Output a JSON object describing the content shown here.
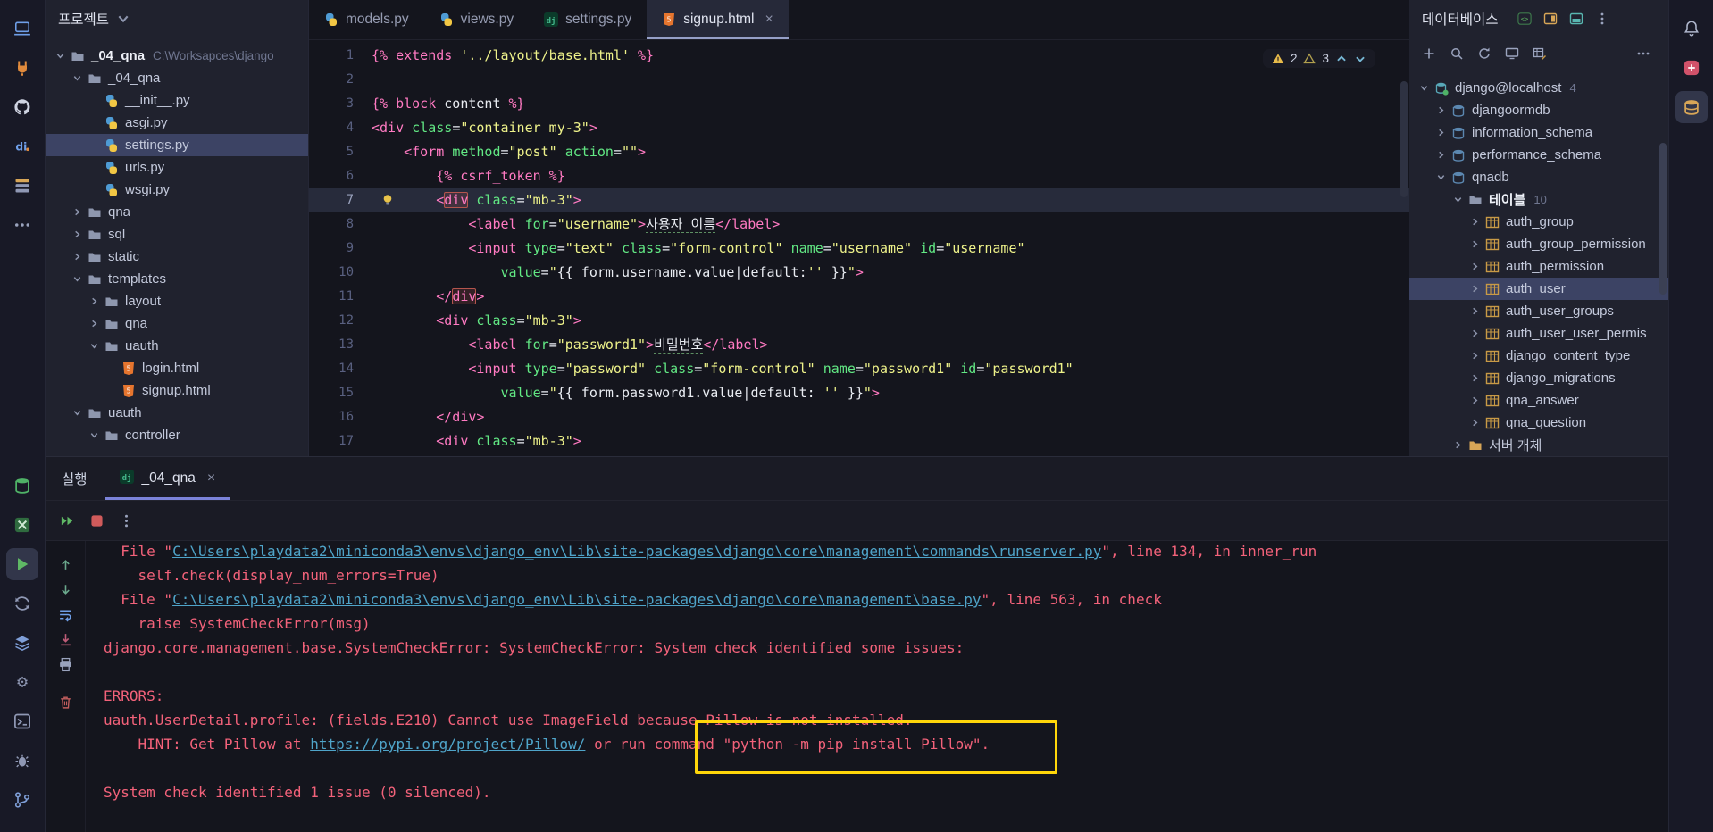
{
  "project_panel": {
    "title": "프로젝트",
    "tree": [
      {
        "label": "_04_qna",
        "hint": "C:\\Worksapces\\django",
        "indent": 0,
        "chevron": "down",
        "icon": "folder",
        "bold": true
      },
      {
        "label": "_04_qna",
        "indent": 1,
        "chevron": "down",
        "icon": "folder"
      },
      {
        "label": "__init__.py",
        "indent": 2,
        "icon": "py"
      },
      {
        "label": "asgi.py",
        "indent": 2,
        "icon": "py"
      },
      {
        "label": "settings.py",
        "indent": 2,
        "icon": "py",
        "selected": true
      },
      {
        "label": "urls.py",
        "indent": 2,
        "icon": "py"
      },
      {
        "label": "wsgi.py",
        "indent": 2,
        "icon": "py"
      },
      {
        "label": "qna",
        "indent": 1,
        "chevron": "right",
        "icon": "folder"
      },
      {
        "label": "sql",
        "indent": 1,
        "chevron": "right",
        "icon": "folder"
      },
      {
        "label": "static",
        "indent": 1,
        "chevron": "right",
        "icon": "folder"
      },
      {
        "label": "templates",
        "indent": 1,
        "chevron": "down",
        "icon": "folder"
      },
      {
        "label": "layout",
        "indent": 2,
        "chevron": "right",
        "icon": "folder"
      },
      {
        "label": "qna",
        "indent": 2,
        "chevron": "right",
        "icon": "folder"
      },
      {
        "label": "uauth",
        "indent": 2,
        "chevron": "down",
        "icon": "folder"
      },
      {
        "label": "login.html",
        "indent": 3,
        "icon": "html"
      },
      {
        "label": "signup.html",
        "indent": 3,
        "icon": "html"
      },
      {
        "label": "uauth",
        "indent": 1,
        "chevron": "down",
        "icon": "folder"
      },
      {
        "label": "controller",
        "indent": 2,
        "chevron": "down",
        "icon": "folder"
      }
    ]
  },
  "editor": {
    "tabs": [
      {
        "label": "models.py",
        "icon": "py"
      },
      {
        "label": "views.py",
        "icon": "py"
      },
      {
        "label": "settings.py",
        "icon": "dj"
      },
      {
        "label": "signup.html",
        "icon": "html",
        "active": true,
        "close": "×"
      }
    ],
    "inspections": {
      "warnings": "2",
      "weak_warnings": "3"
    },
    "current_line": 7,
    "code_lines": [
      [
        [
          "p",
          "{% "
        ],
        [
          "p",
          "extends "
        ],
        [
          "y",
          "'../layout/base.html'"
        ],
        [
          "p",
          " %}"
        ]
      ],
      [],
      [
        [
          "p",
          "{% "
        ],
        [
          "p",
          "block "
        ],
        [
          "w",
          "content"
        ],
        [
          "p",
          " %}"
        ]
      ],
      [
        [
          "p",
          "<div "
        ],
        [
          "g",
          "class"
        ],
        [
          "w",
          "="
        ],
        [
          "y",
          "\"container my-3\""
        ],
        [
          "p",
          ">"
        ]
      ],
      [
        [
          "w",
          "    "
        ],
        [
          "p",
          "<form "
        ],
        [
          "g",
          "method"
        ],
        [
          "w",
          "="
        ],
        [
          "y",
          "\"post\""
        ],
        [
          "w",
          " "
        ],
        [
          "g",
          "action"
        ],
        [
          "w",
          "="
        ],
        [
          "y",
          "\"\""
        ],
        [
          "p",
          ">"
        ]
      ],
      [
        [
          "w",
          "        "
        ],
        [
          "p",
          "{% csrf_token %}"
        ]
      ],
      [
        [
          "w",
          "        "
        ],
        [
          "p",
          "<"
        ],
        [
          "pb",
          "div"
        ],
        [
          "w",
          " "
        ],
        [
          "g",
          "class"
        ],
        [
          "w",
          "="
        ],
        [
          "y",
          "\"mb-3\""
        ],
        [
          "p",
          ">"
        ]
      ],
      [
        [
          "w",
          "            "
        ],
        [
          "p",
          "<label "
        ],
        [
          "g",
          "for"
        ],
        [
          "w",
          "="
        ],
        [
          "y",
          "\"username\""
        ],
        [
          "p",
          ">"
        ],
        [
          "wu",
          "사용자 이름"
        ],
        [
          "p",
          "</label>"
        ]
      ],
      [
        [
          "w",
          "            "
        ],
        [
          "p",
          "<input "
        ],
        [
          "g",
          "type"
        ],
        [
          "w",
          "="
        ],
        [
          "y",
          "\"text\""
        ],
        [
          "w",
          " "
        ],
        [
          "g",
          "class"
        ],
        [
          "w",
          "="
        ],
        [
          "y",
          "\"form-control\""
        ],
        [
          "w",
          " "
        ],
        [
          "g",
          "name"
        ],
        [
          "w",
          "="
        ],
        [
          "y",
          "\"username\""
        ],
        [
          "w",
          " "
        ],
        [
          "g",
          "id"
        ],
        [
          "w",
          "="
        ],
        [
          "y",
          "\"username\""
        ]
      ],
      [
        [
          "w",
          "                "
        ],
        [
          "g",
          "value"
        ],
        [
          "w",
          "="
        ],
        [
          "y",
          "\""
        ],
        [
          "w",
          "{{ form.username.value|default:"
        ],
        [
          "y",
          "''"
        ],
        [
          "w",
          " }}"
        ],
        [
          "y",
          "\""
        ],
        [
          "p",
          ">"
        ]
      ],
      [
        [
          "w",
          "        "
        ],
        [
          "p",
          "</"
        ],
        [
          "pb",
          "div"
        ],
        [
          "p",
          ">"
        ]
      ],
      [
        [
          "w",
          "        "
        ],
        [
          "p",
          "<div "
        ],
        [
          "g",
          "class"
        ],
        [
          "w",
          "="
        ],
        [
          "y",
          "\"mb-3\""
        ],
        [
          "p",
          ">"
        ]
      ],
      [
        [
          "w",
          "            "
        ],
        [
          "p",
          "<label "
        ],
        [
          "g",
          "for"
        ],
        [
          "w",
          "="
        ],
        [
          "y",
          "\"password1\""
        ],
        [
          "p",
          ">"
        ],
        [
          "wu",
          "비밀번호"
        ],
        [
          "p",
          "</label>"
        ]
      ],
      [
        [
          "w",
          "            "
        ],
        [
          "p",
          "<input "
        ],
        [
          "g",
          "type"
        ],
        [
          "w",
          "="
        ],
        [
          "y",
          "\"password\""
        ],
        [
          "w",
          " "
        ],
        [
          "g",
          "class"
        ],
        [
          "w",
          "="
        ],
        [
          "y",
          "\"form-control\""
        ],
        [
          "w",
          " "
        ],
        [
          "g",
          "name"
        ],
        [
          "w",
          "="
        ],
        [
          "y",
          "\"password1\""
        ],
        [
          "w",
          " "
        ],
        [
          "g",
          "id"
        ],
        [
          "w",
          "="
        ],
        [
          "y",
          "\"password1\""
        ]
      ],
      [
        [
          "w",
          "                "
        ],
        [
          "g",
          "value"
        ],
        [
          "w",
          "="
        ],
        [
          "y",
          "\""
        ],
        [
          "w",
          "{{ form.password1.value|default: "
        ],
        [
          "y",
          "''"
        ],
        [
          "w",
          " }}"
        ],
        [
          "y",
          "\""
        ],
        [
          "p",
          ">"
        ]
      ],
      [
        [
          "w",
          "        "
        ],
        [
          "p",
          "</div>"
        ]
      ],
      [
        [
          "w",
          "        "
        ],
        [
          "p",
          "<div "
        ],
        [
          "g",
          "class"
        ],
        [
          "w",
          "="
        ],
        [
          "y",
          "\"mb-3\""
        ],
        [
          "p",
          ">"
        ]
      ]
    ]
  },
  "db_panel": {
    "title": "데이터베이스",
    "header_icons": [
      "terminal-green",
      "layout-orange",
      "layout-teal",
      "kebab"
    ],
    "toolbar_icons": [
      "plus",
      "magnifier",
      "refresh",
      "monitor",
      "table-edit",
      "more"
    ],
    "tree": [
      {
        "label": "django@localhost",
        "badge": "4",
        "indent": 0,
        "chevron": "down",
        "icon": "dbconn"
      },
      {
        "label": "djangoormdb",
        "indent": 1,
        "chevron": "right",
        "icon": "schema"
      },
      {
        "label": "information_schema",
        "indent": 1,
        "chevron": "right",
        "icon": "schema"
      },
      {
        "label": "performance_schema",
        "indent": 1,
        "chevron": "right",
        "icon": "schema"
      },
      {
        "label": "qnadb",
        "indent": 1,
        "chevron": "down",
        "icon": "schema"
      },
      {
        "label": "테이블",
        "badge": "10",
        "indent": 2,
        "chevron": "down",
        "icon": "folder",
        "bold": true
      },
      {
        "label": "auth_group",
        "indent": 3,
        "chevron": "right",
        "icon": "table"
      },
      {
        "label": "auth_group_permission",
        "indent": 3,
        "chevron": "right",
        "icon": "table"
      },
      {
        "label": "auth_permission",
        "indent": 3,
        "chevron": "right",
        "icon": "table"
      },
      {
        "label": "auth_user",
        "indent": 3,
        "chevron": "right",
        "icon": "table",
        "selected": true
      },
      {
        "label": "auth_user_groups",
        "indent": 3,
        "chevron": "right",
        "icon": "table"
      },
      {
        "label": "auth_user_user_permis",
        "indent": 3,
        "chevron": "right",
        "icon": "table"
      },
      {
        "label": "django_content_type",
        "indent": 3,
        "chevron": "right",
        "icon": "table"
      },
      {
        "label": "django_migrations",
        "indent": 3,
        "chevron": "right",
        "icon": "table"
      },
      {
        "label": "qna_answer",
        "indent": 3,
        "chevron": "right",
        "icon": "table"
      },
      {
        "label": "qna_question",
        "indent": 3,
        "chevron": "right",
        "icon": "table"
      },
      {
        "label": "서버 개체",
        "indent": 2,
        "chevron": "right",
        "icon": "folder-orange"
      }
    ]
  },
  "run_panel": {
    "window_label": "실행",
    "tab_label": "_04_qna",
    "tab_icon": "dj",
    "close_glyph": "×",
    "toolbar_icons": [
      "rerun",
      "stop",
      "kebab"
    ],
    "gutter_icons": [
      "up-arrow",
      "down-arrow",
      "soft-wrap",
      "scroll-end",
      "printer",
      "trash"
    ],
    "console_lines": [
      [
        [
          "err",
          "  File \""
        ],
        [
          "lnk",
          "C:\\Users\\playdata2\\miniconda3\\envs\\django_env\\Lib\\site-packages\\django\\core\\management\\commands\\runserver.py"
        ],
        [
          "err",
          "\", line 134, in inner_run"
        ]
      ],
      [
        [
          "err",
          "    self.check(display_num_errors=True)"
        ]
      ],
      [
        [
          "err",
          "  File \""
        ],
        [
          "lnk",
          "C:\\Users\\playdata2\\miniconda3\\envs\\django_env\\Lib\\site-packages\\django\\core\\management\\base.py"
        ],
        [
          "err",
          "\", line 563, in check"
        ]
      ],
      [
        [
          "err",
          "    raise SystemCheckError(msg)"
        ]
      ],
      [
        [
          "err",
          "django.core.management.base.SystemCheckError: SystemCheckError: System check identified some issues:"
        ]
      ],
      [],
      [
        [
          "err",
          "ERRORS:"
        ]
      ],
      [
        [
          "err",
          "uauth.UserDetail.profile: (fields.E210) Cannot use ImageField because Pillow is not installed."
        ]
      ],
      [
        [
          "err",
          "    HINT: Get Pillow at "
        ],
        [
          "lnk",
          "https://pypi.org/project/Pillow/"
        ],
        [
          "err",
          " or run command \"python -m pip install Pillow\"."
        ]
      ],
      [],
      [
        [
          "err",
          "System check identified 1 issue (0 silenced)."
        ]
      ]
    ]
  },
  "activity_bar_left": {
    "top": [
      {
        "icon": "laptop"
      },
      {
        "icon": "plug"
      },
      {
        "icon": "github"
      },
      {
        "icon": "dbnav"
      },
      {
        "icon": "bookmarks"
      },
      {
        "icon": "more"
      }
    ],
    "bottom": [
      {
        "icon": "services-db"
      },
      {
        "icon": "sql-file"
      },
      {
        "icon": "run",
        "active": true
      },
      {
        "icon": "sync"
      },
      {
        "icon": "layers"
      },
      {
        "icon": "gear"
      },
      {
        "icon": "terminal"
      },
      {
        "icon": "bug"
      },
      {
        "icon": "git-branch"
      }
    ]
  },
  "activity_bar_right": {
    "top": [
      {
        "icon": "bell"
      },
      {
        "icon": "red-badge"
      },
      {
        "icon": "database-amber",
        "active": true
      }
    ]
  },
  "colors": {
    "keyword_pink": "#ff7ac2",
    "string_yellow": "#eef28a",
    "attr_green": "#62e884",
    "error_red": "#f3627a",
    "link_blue": "#4fa4c9",
    "annotation_yellow": "#ffd60a",
    "selection_blue": "#3c4364"
  }
}
